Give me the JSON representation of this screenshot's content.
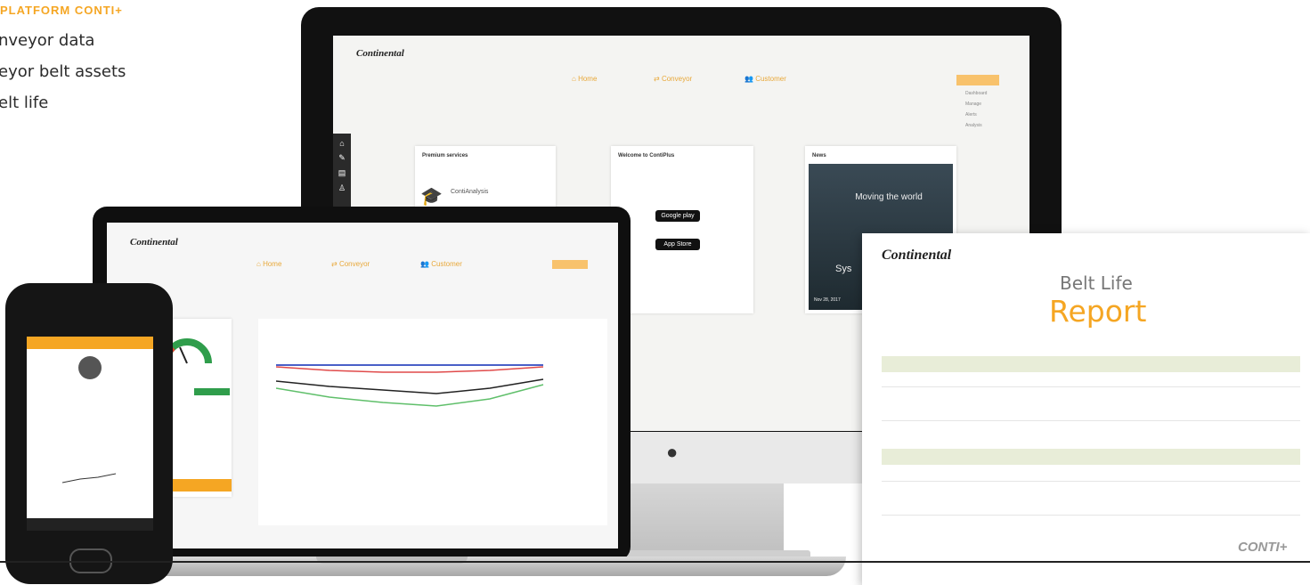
{
  "intro": {
    "headline": "PLATFORM CONTI+",
    "bullets": [
      "nveyor data",
      "eyor belt assets",
      "elt life"
    ]
  },
  "brand": {
    "logo": "Continental",
    "accent": "#f5a623"
  },
  "imac": {
    "nav": [
      "Home",
      "Conveyor",
      "Customer"
    ],
    "cards": {
      "premium": {
        "title": "Premium services",
        "item": "ContiAnalysis"
      },
      "welcome": {
        "title": "Welcome to ContiPlus",
        "google": "Google play",
        "apple": "App Store"
      },
      "news": {
        "title": "News",
        "overlay": "Moving the world",
        "caption": "Sys",
        "date": "Nov 28, 2017"
      }
    },
    "side_menu": [
      "Dashboard",
      "Manage",
      "Alerts",
      "Analysis"
    ]
  },
  "laptop": {
    "nav": [
      "Home",
      "Conveyor",
      "Customer"
    ]
  },
  "report": {
    "title_line1": "Belt Life",
    "title_line2": "Report",
    "logo_footer": "CONTI+",
    "icons": {
      "brand_mark": "continental-horse-icon"
    }
  }
}
